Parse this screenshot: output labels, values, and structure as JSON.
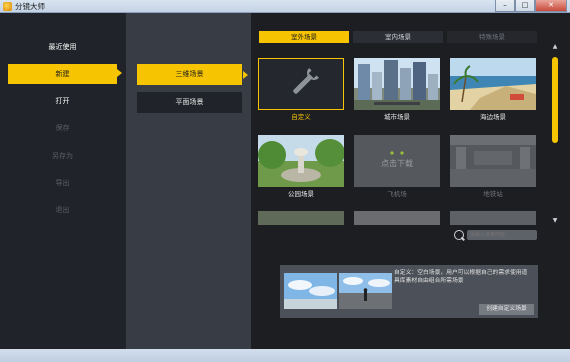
{
  "window": {
    "title": "分镜大师",
    "minimize": "–",
    "maximize": "□",
    "close": "✕"
  },
  "nav": {
    "items": [
      {
        "label": "最近使用",
        "state": "normal"
      },
      {
        "label": "新建",
        "state": "active"
      },
      {
        "label": "打开",
        "state": "normal"
      },
      {
        "label": "保存",
        "state": "disabled"
      },
      {
        "label": "另存为",
        "state": "disabled"
      },
      {
        "label": "导出",
        "state": "disabled"
      },
      {
        "label": "退出",
        "state": "disabled"
      }
    ]
  },
  "scene_type": {
    "items": [
      {
        "label": "三维场景",
        "state": "active"
      },
      {
        "label": "平面场景",
        "state": "normal"
      }
    ]
  },
  "tabs": [
    {
      "label": "室外场景",
      "state": "active"
    },
    {
      "label": "室内场景",
      "state": "normal"
    },
    {
      "label": "特殊场景",
      "state": "dim"
    }
  ],
  "scenes": [
    {
      "label": "自定义",
      "icon": "wrench-icon",
      "state": "selected"
    },
    {
      "label": "城市场景",
      "state": "normal"
    },
    {
      "label": "海边场景",
      "state": "normal"
    },
    {
      "label": "公园场景",
      "state": "normal"
    },
    {
      "label": "飞机场",
      "state": "download",
      "overlay": "点击下载"
    },
    {
      "label": "地铁站",
      "state": "dim"
    }
  ],
  "search": {
    "placeholder": "请输入搜索内容"
  },
  "info": {
    "description": "自定义：空白场景，用户可以根据自己的需求使用道具库素材自由组合所需场景",
    "create_button": "创建自定义场景"
  },
  "colors": {
    "accent": "#f6c400",
    "nav_bg": "#202329",
    "mid_bg": "#383c44",
    "panel_bg": "#1d1e21"
  }
}
